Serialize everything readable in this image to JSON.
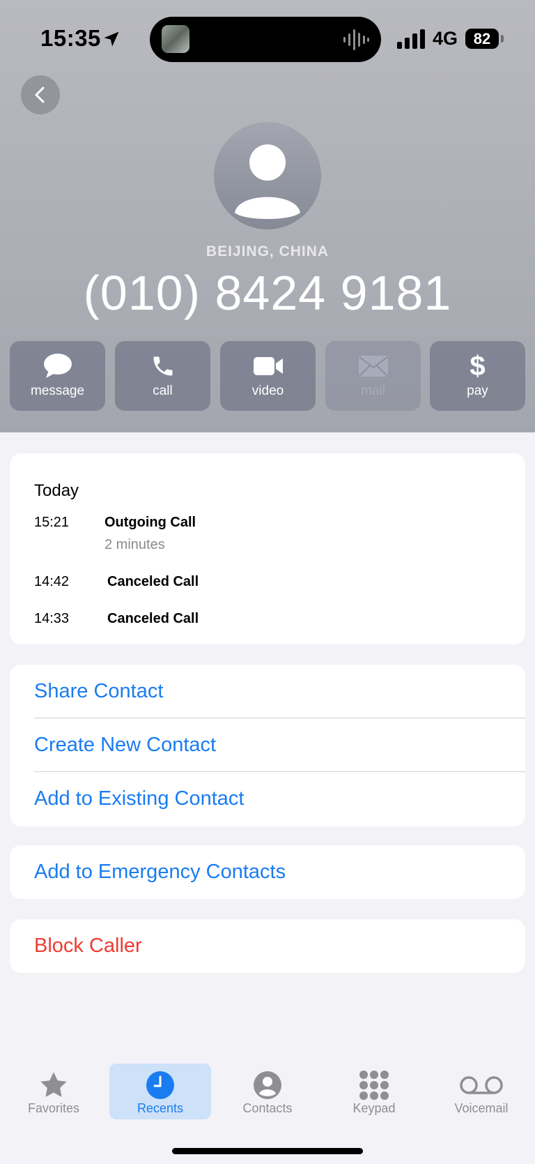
{
  "status_bar": {
    "time": "15:35",
    "network": "4G",
    "battery": "82"
  },
  "contact": {
    "location": "BEIJING, CHINA",
    "phone_number": "(010) 8424 9181"
  },
  "actions": [
    {
      "label": "message",
      "icon": "message-bubble-icon",
      "enabled": true
    },
    {
      "label": "call",
      "icon": "phone-icon",
      "enabled": true
    },
    {
      "label": "video",
      "icon": "video-camera-icon",
      "enabled": true
    },
    {
      "label": "mail",
      "icon": "envelope-icon",
      "enabled": false
    },
    {
      "label": "pay",
      "icon": "dollar-icon",
      "enabled": true
    }
  ],
  "recents": {
    "title": "Today",
    "calls": [
      {
        "time": "15:21",
        "type": "Outgoing Call",
        "duration": "2 minutes"
      },
      {
        "time": "14:42",
        "type": "Canceled Call"
      },
      {
        "time": "14:33",
        "type": "Canceled Call"
      }
    ]
  },
  "contact_options": {
    "share": "Share Contact",
    "create": "Create New Contact",
    "add_existing": "Add to Existing Contact"
  },
  "emergency": "Add to Emergency Contacts",
  "block": "Block Caller",
  "tabs": [
    {
      "label": "Favorites",
      "icon": "star-icon",
      "active": false
    },
    {
      "label": "Recents",
      "icon": "clock-icon",
      "active": true
    },
    {
      "label": "Contacts",
      "icon": "person-circle-icon",
      "active": false
    },
    {
      "label": "Keypad",
      "icon": "keypad-icon",
      "active": false
    },
    {
      "label": "Voicemail",
      "icon": "voicemail-icon",
      "active": false
    }
  ],
  "colors": {
    "accent": "#1a7cf0",
    "destructive": "#ef3b34",
    "header_gradient_top": "#b9babf",
    "header_gradient_bottom": "#a4a6af"
  }
}
